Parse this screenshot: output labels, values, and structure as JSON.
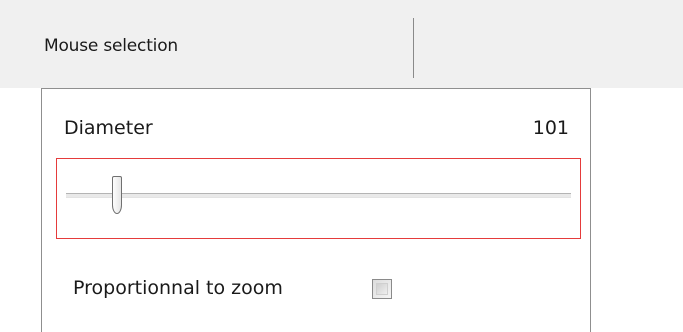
{
  "header": {
    "title": "Mouse selection"
  },
  "diameter": {
    "label": "Diameter",
    "value": "101",
    "slider_fraction": 0.1
  },
  "proportional": {
    "label": "Proportionnal to zoom",
    "checked": false
  },
  "colors": {
    "focus_border": "#e53b3b",
    "header_background": "#f0f0f0"
  }
}
